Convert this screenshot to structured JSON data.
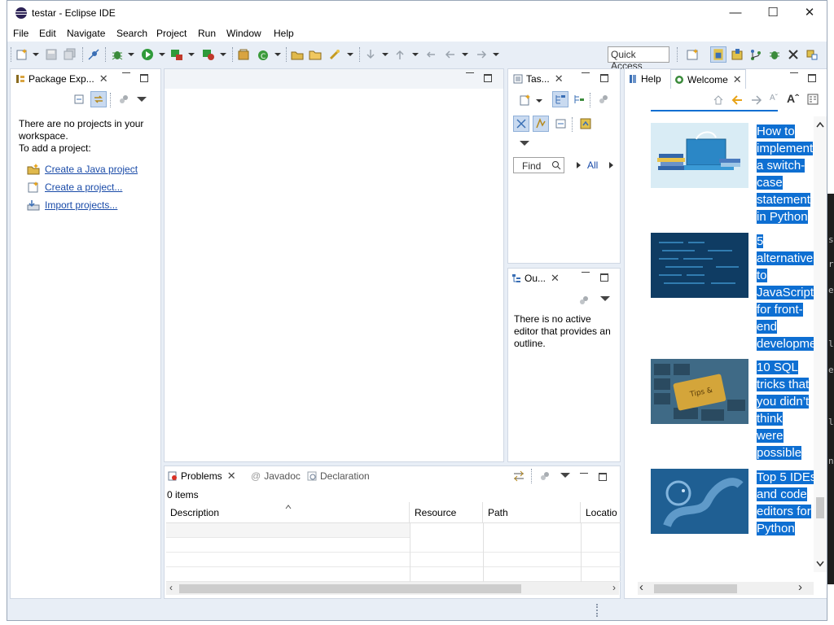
{
  "window": {
    "title": "testar - Eclipse IDE"
  },
  "menu": [
    "File",
    "Edit",
    "Navigate",
    "Search",
    "Project",
    "Run",
    "Window",
    "Help"
  ],
  "toolbar": {
    "quick_access": "Quick Access"
  },
  "package_explorer": {
    "tab_label": "Package Exp...",
    "empty_line1": "There are no projects in your",
    "empty_line2": "workspace.",
    "empty_line3": "To add a project:",
    "links": [
      "Create a Java project",
      "Create a project...",
      "Import projects..."
    ]
  },
  "task_list": {
    "tab_label": "Tas...",
    "find_placeholder": "Find",
    "all_label": "All"
  },
  "outline": {
    "tab_label": "Ou...",
    "message_line1": "There is no active",
    "message_line2": "editor that provides an",
    "message_line3": "outline."
  },
  "bottom": {
    "tabs": [
      "Problems",
      "Javadoc",
      "Declaration"
    ],
    "item_count": "0 items",
    "columns": [
      "Description",
      "Resource",
      "Path",
      "Locatio"
    ]
  },
  "right_panel": {
    "tabs": [
      "Help",
      "Welcome"
    ],
    "articles": [
      {
        "title_lines": [
          "How to",
          "implement",
          "a switch-",
          "case",
          "statement",
          "in Python"
        ],
        "image": "books-laptop-illustration"
      },
      {
        "title_lines": [
          "5",
          "alternatives",
          "to",
          "JavaScript",
          "for front-",
          "end",
          "developmen"
        ],
        "image": "code-screen-photo"
      },
      {
        "title_lines": [
          "10 SQL",
          "tricks that",
          "you didn’t",
          "think",
          "were",
          "possible"
        ],
        "image": "keyboard-tips-key-photo"
      },
      {
        "title_lines": [
          "Top 5 IDEs",
          "and code",
          "editors for",
          "Python"
        ],
        "image": "python-snake-illustration"
      }
    ]
  },
  "colors": {
    "accent": "#0e6fd2",
    "link": "#1a4ba8",
    "chrome": "#e8eef6"
  }
}
